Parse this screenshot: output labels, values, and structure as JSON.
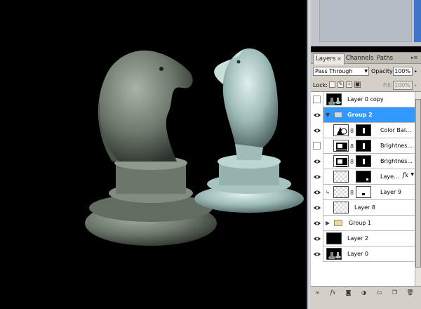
{
  "panel": {
    "tabs": [
      {
        "label": "Layers",
        "close": "×",
        "active": true
      },
      {
        "label": "Channels",
        "active": false
      },
      {
        "label": "Paths",
        "active": false
      }
    ],
    "menu_icon": "panel-menu-icon",
    "blend_mode": "Pass Through",
    "opacity_label": "Opacity:",
    "opacity_value": "100%",
    "lock_label": "Lock:",
    "fill_label": "Fill:",
    "fill_value": "100%"
  },
  "layers": [
    {
      "name": "Layer 0 copy",
      "visible": false,
      "selected": false,
      "type": "pixel"
    },
    {
      "name": "Group 2",
      "visible": true,
      "selected": true,
      "type": "group-open"
    },
    {
      "name": "Color Bal...",
      "visible": true,
      "selected": false,
      "type": "adjustment-color"
    },
    {
      "name": "Brightnes...",
      "visible": false,
      "selected": false,
      "type": "adjustment-brightness"
    },
    {
      "name": "Brightnes...",
      "visible": true,
      "selected": false,
      "type": "adjustment-brightness"
    },
    {
      "name": "Laye...",
      "visible": true,
      "selected": false,
      "type": "masked-fx",
      "fx": "fx"
    },
    {
      "name": "Layer 9",
      "visible": true,
      "selected": false,
      "type": "masked-white"
    },
    {
      "name": "Layer 8",
      "visible": true,
      "selected": false,
      "type": "checker"
    },
    {
      "name": "Group 1",
      "visible": true,
      "selected": false,
      "type": "group-closed"
    },
    {
      "name": "Layer 2",
      "visible": true,
      "selected": false,
      "type": "black"
    },
    {
      "name": "Layer 0",
      "visible": true,
      "selected": false,
      "type": "pixel"
    }
  ],
  "footer_icons": [
    "link-layers-icon",
    "fx-icon",
    "add-mask-icon",
    "adjustment-icon",
    "new-group-icon",
    "new-layer-icon",
    "trash-icon"
  ],
  "colors": {
    "selection": "#3399ff",
    "panel_bg": "#d4d0c8",
    "canvas_bg": "#000000"
  }
}
